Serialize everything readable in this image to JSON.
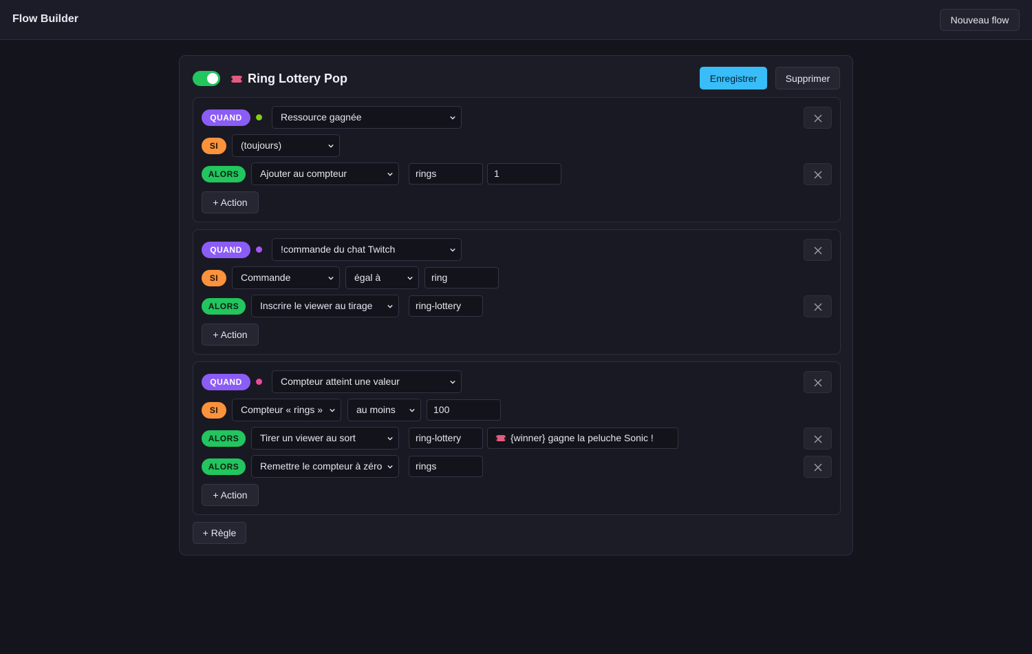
{
  "header": {
    "title": "Flow Builder",
    "new_flow_label": "Nouveau flow"
  },
  "flow": {
    "enabled": true,
    "title": "Ring Lottery Pop",
    "save_label": "Enregistrer",
    "delete_label": "Supprimer",
    "add_rule_label": "+ Règle",
    "rules": [
      {
        "when": {
          "pill": "QUAND",
          "dot_color": "#84cc16",
          "trigger": "Ressource gagnée"
        },
        "if": {
          "pill": "SI",
          "condition": "(toujours)"
        },
        "actions": [
          {
            "pill": "ALORS",
            "action": "Ajouter au compteur",
            "params": [
              "rings",
              "1"
            ]
          }
        ],
        "add_action_label": "+ Action"
      },
      {
        "when": {
          "pill": "QUAND",
          "dot_color": "#a855f7",
          "trigger": "!commande du chat Twitch"
        },
        "if": {
          "pill": "SI",
          "condition": "Commande",
          "operator": "égal à",
          "value": "ring"
        },
        "actions": [
          {
            "pill": "ALORS",
            "action": "Inscrire le viewer au tirage",
            "params": [
              "ring-lottery"
            ]
          }
        ],
        "add_action_label": "+ Action"
      },
      {
        "when": {
          "pill": "QUAND",
          "dot_color": "#ec4899",
          "trigger": "Compteur atteint une valeur"
        },
        "if": {
          "pill": "SI",
          "condition": "Compteur « rings »",
          "operator": "au moins",
          "value": "100"
        },
        "actions": [
          {
            "pill": "ALORS",
            "action": "Tirer un viewer au sort",
            "params": [
              "ring-lottery",
              "{winner} gagne la peluche Sonic !"
            ]
          },
          {
            "pill": "ALORS",
            "action": "Remettre le compteur à zéro",
            "params": [
              "rings"
            ]
          }
        ],
        "add_action_label": "+ Action"
      }
    ]
  },
  "icons": {
    "toggle": "toggle-switch",
    "ticket": "ticket-icon",
    "close": "close-icon",
    "chevron": "chevron-down-icon"
  },
  "colors": {
    "accent": "#38bdf8",
    "quand": "#8b5cf6",
    "si": "#fb923c",
    "alors": "#22c55e"
  }
}
